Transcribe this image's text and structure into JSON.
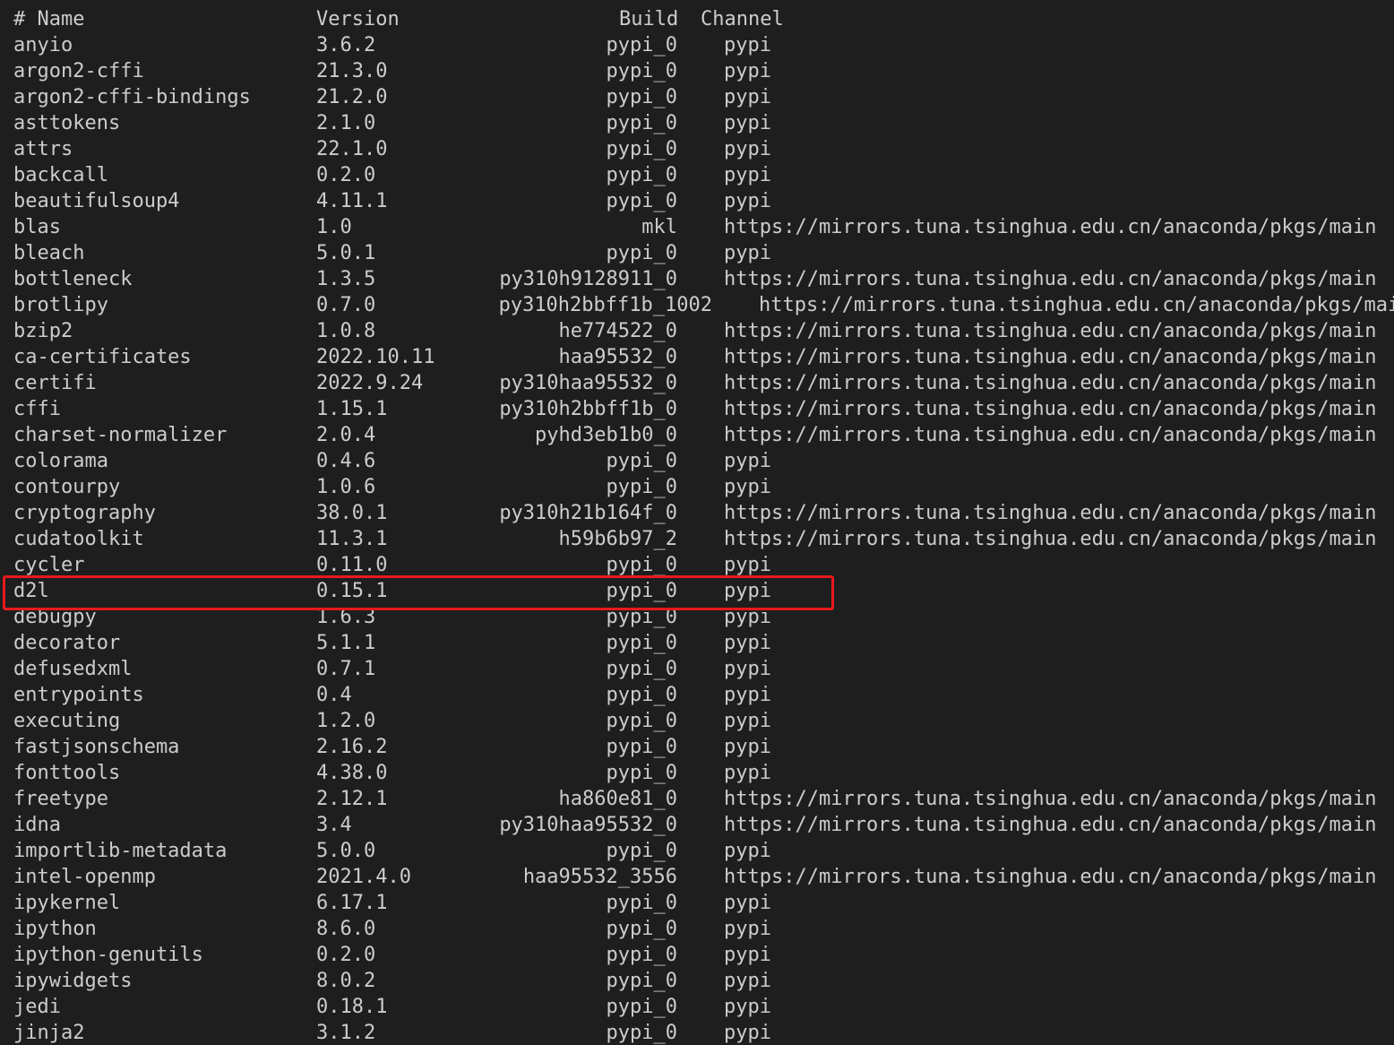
{
  "colors": {
    "background": "#1e1e1e",
    "text": "#cccccc",
    "highlight": "#e8191e"
  },
  "header": {
    "name": "# Name",
    "version": "Version",
    "build": "Build",
    "channel": "Channel"
  },
  "highlighted_package": "d2l",
  "packages": [
    {
      "name": "anyio",
      "version": "3.6.2",
      "build": "pypi_0",
      "channel": "pypi"
    },
    {
      "name": "argon2-cffi",
      "version": "21.3.0",
      "build": "pypi_0",
      "channel": "pypi"
    },
    {
      "name": "argon2-cffi-bindings",
      "version": "21.2.0",
      "build": "pypi_0",
      "channel": "pypi"
    },
    {
      "name": "asttokens",
      "version": "2.1.0",
      "build": "pypi_0",
      "channel": "pypi"
    },
    {
      "name": "attrs",
      "version": "22.1.0",
      "build": "pypi_0",
      "channel": "pypi"
    },
    {
      "name": "backcall",
      "version": "0.2.0",
      "build": "pypi_0",
      "channel": "pypi"
    },
    {
      "name": "beautifulsoup4",
      "version": "4.11.1",
      "build": "pypi_0",
      "channel": "pypi"
    },
    {
      "name": "blas",
      "version": "1.0",
      "build": "mkl",
      "channel": "https://mirrors.tuna.tsinghua.edu.cn/anaconda/pkgs/main"
    },
    {
      "name": "bleach",
      "version": "5.0.1",
      "build": "pypi_0",
      "channel": "pypi"
    },
    {
      "name": "bottleneck",
      "version": "1.3.5",
      "build": "py310h9128911_0",
      "channel": "https://mirrors.tuna.tsinghua.edu.cn/anaconda/pkgs/main"
    },
    {
      "name": "brotlipy",
      "version": "0.7.0",
      "build": "py310h2bbff1b_1002",
      "channel": "https://mirrors.tuna.tsinghua.edu.cn/anaconda/pkgs/main"
    },
    {
      "name": "bzip2",
      "version": "1.0.8",
      "build": "he774522_0",
      "channel": "https://mirrors.tuna.tsinghua.edu.cn/anaconda/pkgs/main"
    },
    {
      "name": "ca-certificates",
      "version": "2022.10.11",
      "build": "haa95532_0",
      "channel": "https://mirrors.tuna.tsinghua.edu.cn/anaconda/pkgs/main"
    },
    {
      "name": "certifi",
      "version": "2022.9.24",
      "build": "py310haa95532_0",
      "channel": "https://mirrors.tuna.tsinghua.edu.cn/anaconda/pkgs/main"
    },
    {
      "name": "cffi",
      "version": "1.15.1",
      "build": "py310h2bbff1b_0",
      "channel": "https://mirrors.tuna.tsinghua.edu.cn/anaconda/pkgs/main"
    },
    {
      "name": "charset-normalizer",
      "version": "2.0.4",
      "build": "pyhd3eb1b0_0",
      "channel": "https://mirrors.tuna.tsinghua.edu.cn/anaconda/pkgs/main"
    },
    {
      "name": "colorama",
      "version": "0.4.6",
      "build": "pypi_0",
      "channel": "pypi"
    },
    {
      "name": "contourpy",
      "version": "1.0.6",
      "build": "pypi_0",
      "channel": "pypi"
    },
    {
      "name": "cryptography",
      "version": "38.0.1",
      "build": "py310h21b164f_0",
      "channel": "https://mirrors.tuna.tsinghua.edu.cn/anaconda/pkgs/main"
    },
    {
      "name": "cudatoolkit",
      "version": "11.3.1",
      "build": "h59b6b97_2",
      "channel": "https://mirrors.tuna.tsinghua.edu.cn/anaconda/pkgs/main"
    },
    {
      "name": "cycler",
      "version": "0.11.0",
      "build": "pypi_0",
      "channel": "pypi"
    },
    {
      "name": "d2l",
      "version": "0.15.1",
      "build": "pypi_0",
      "channel": "pypi"
    },
    {
      "name": "debugpy",
      "version": "1.6.3",
      "build": "pypi_0",
      "channel": "pypi"
    },
    {
      "name": "decorator",
      "version": "5.1.1",
      "build": "pypi_0",
      "channel": "pypi"
    },
    {
      "name": "defusedxml",
      "version": "0.7.1",
      "build": "pypi_0",
      "channel": "pypi"
    },
    {
      "name": "entrypoints",
      "version": "0.4",
      "build": "pypi_0",
      "channel": "pypi"
    },
    {
      "name": "executing",
      "version": "1.2.0",
      "build": "pypi_0",
      "channel": "pypi"
    },
    {
      "name": "fastjsonschema",
      "version": "2.16.2",
      "build": "pypi_0",
      "channel": "pypi"
    },
    {
      "name": "fonttools",
      "version": "4.38.0",
      "build": "pypi_0",
      "channel": "pypi"
    },
    {
      "name": "freetype",
      "version": "2.12.1",
      "build": "ha860e81_0",
      "channel": "https://mirrors.tuna.tsinghua.edu.cn/anaconda/pkgs/main"
    },
    {
      "name": "idna",
      "version": "3.4",
      "build": "py310haa95532_0",
      "channel": "https://mirrors.tuna.tsinghua.edu.cn/anaconda/pkgs/main"
    },
    {
      "name": "importlib-metadata",
      "version": "5.0.0",
      "build": "pypi_0",
      "channel": "pypi"
    },
    {
      "name": "intel-openmp",
      "version": "2021.4.0",
      "build": "haa95532_3556",
      "channel": "https://mirrors.tuna.tsinghua.edu.cn/anaconda/pkgs/main"
    },
    {
      "name": "ipykernel",
      "version": "6.17.1",
      "build": "pypi_0",
      "channel": "pypi"
    },
    {
      "name": "ipython",
      "version": "8.6.0",
      "build": "pypi_0",
      "channel": "pypi"
    },
    {
      "name": "ipython-genutils",
      "version": "0.2.0",
      "build": "pypi_0",
      "channel": "pypi"
    },
    {
      "name": "ipywidgets",
      "version": "8.0.2",
      "build": "pypi_0",
      "channel": "pypi"
    },
    {
      "name": "jedi",
      "version": "0.18.1",
      "build": "pypi_0",
      "channel": "pypi"
    },
    {
      "name": "jinja2",
      "version": "3.1.2",
      "build": "pypi_0",
      "channel": "pypi"
    }
  ]
}
